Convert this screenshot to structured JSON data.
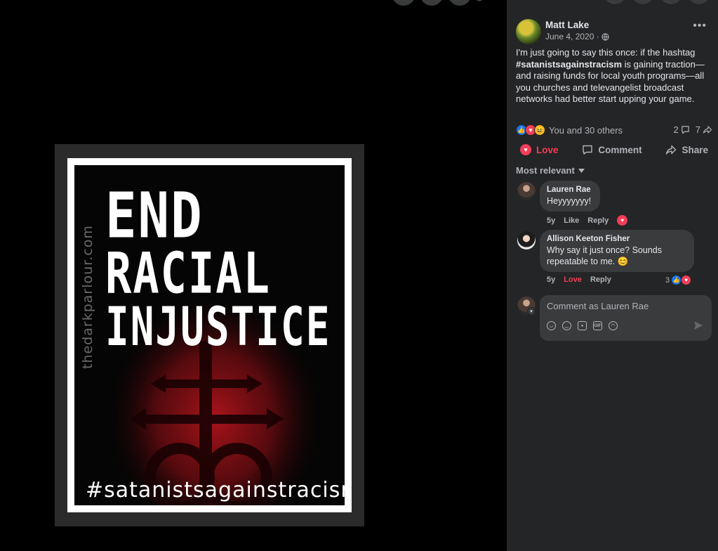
{
  "post": {
    "author": "Matt Lake",
    "date": "June 4, 2020 ·",
    "more": "•••",
    "text_before": "I'm just going to say this once: if the hashtag",
    "hashtag": "#satanistsagainstracism",
    "text_after": " is gaining traction—and raising funds for local youth programs—all you churches and televangelist broadcast networks had better start upping your game.",
    "reaction_summary": "You and 30 others",
    "comment_count": "2",
    "share_count": "7",
    "actions": {
      "love": "Love",
      "comment": "Comment",
      "share": "Share"
    },
    "filter": "Most relevant"
  },
  "poster": {
    "side_url": "thedarkparlour.com",
    "line1": "END",
    "line2": "RACIAL",
    "line3": "INJUSTICE",
    "hashtag": "#satanistsagainstracism"
  },
  "comments": [
    {
      "name": "Lauren Rae",
      "text": "Heyyyyyyy!",
      "time": "5y",
      "like": "Like",
      "reply": "Reply"
    },
    {
      "name": "Allison Keeton Fisher",
      "text": "Why say it just once? Sounds repeatable to me. 😊",
      "time": "5y",
      "like": "Love",
      "reply": "Reply",
      "reactions": "3"
    }
  ],
  "composer": {
    "placeholder": "Comment as Lauren Rae"
  },
  "icons": [
    "globe-icon",
    "like-icon",
    "love-icon",
    "haha-icon",
    "comment-icon",
    "share-icon",
    "chevron-down-icon",
    "sticker-icon",
    "emoji-icon",
    "camera-icon",
    "gif-icon",
    "avatar-sticker-icon",
    "send-icon"
  ],
  "colors": {
    "love": "#f33e58",
    "like": "#1877f2",
    "panel_bg": "#242526",
    "bubble_bg": "#3a3b3c"
  }
}
